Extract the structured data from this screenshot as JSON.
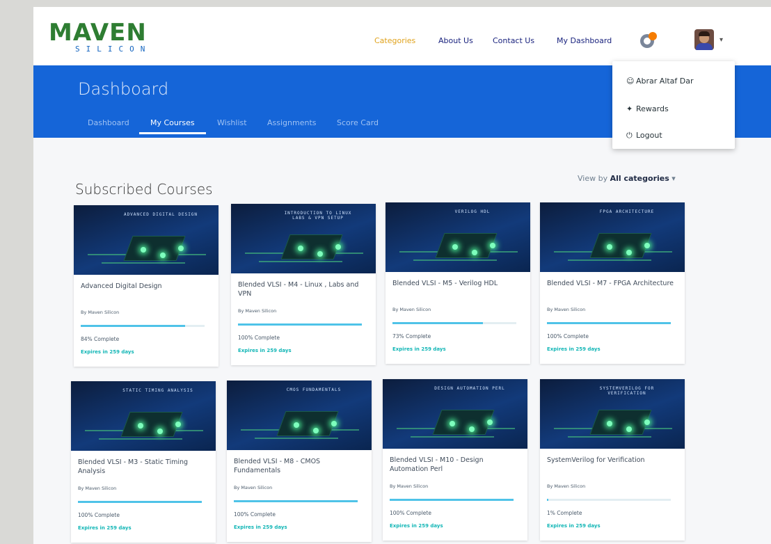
{
  "logo": {
    "main": "MAVEN",
    "sub": "SILICON"
  },
  "nav": [
    "Categories",
    "About Us",
    "Contact Us",
    "My Dashboard"
  ],
  "banner": {
    "title": "Dashboard",
    "tabs": [
      "Dashboard",
      "My Courses",
      "Wishlist",
      "Assignments",
      "Score Card"
    ]
  },
  "user_menu": {
    "items": [
      {
        "icon": "user-icon",
        "label": "Abrar Altaf Dar"
      },
      {
        "icon": "gift-icon",
        "label": "Rewards"
      },
      {
        "icon": "power-icon",
        "label": "Logout"
      }
    ]
  },
  "section_title": "Subscribed Courses",
  "view_by": {
    "prefix": "View by",
    "value": "All categories",
    "caret": "▾"
  },
  "courses": [
    {
      "title": "Advanced Digital Design",
      "by": "By Maven Silicon",
      "progress": 0.84,
      "progress_label": "84% Complete",
      "expire": "Expires in 259 days",
      "thumb_caption": "ADVANCED DIGITAL DESIGN"
    },
    {
      "title": "Blended VLSI - M4 - Linux , Labs and VPN",
      "by": "By Maven Silicon",
      "progress": 1.0,
      "progress_label": "100% Complete",
      "expire": "Expires in 259 days",
      "thumb_caption": "INTRODUCTION TO LINUX LABS & VPN SETUP"
    },
    {
      "title": "Blended VLSI - M5 - Verilog HDL",
      "by": "By Maven Silicon",
      "progress": 0.73,
      "progress_label": "73% Complete",
      "expire": "Expires in 259 days",
      "thumb_caption": "VERILOG HDL"
    },
    {
      "title": "Blended VLSI - M7 - FPGA Architecture",
      "by": "By Maven Silicon",
      "progress": 1.0,
      "progress_label": "100% Complete",
      "expire": "Expires in 259 days",
      "thumb_caption": "FPGA ARCHITECTURE"
    },
    {
      "title": "Blended VLSI - M3 - Static Timing Analysis",
      "by": "By Maven Silicon",
      "progress": 1.0,
      "progress_label": "100% Complete",
      "expire": "Expires in 259 days",
      "thumb_caption": "STATIC TIMING ANALYSIS"
    },
    {
      "title": "Blended VLSI - M8 - CMOS Fundamentals",
      "by": "By Maven Silicon",
      "progress": 1.0,
      "progress_label": "100% Complete",
      "expire": "Expires in 259 days",
      "thumb_caption": "CMOS FUNDAMENTALS"
    },
    {
      "title": "Blended VLSI - M10 - Design Automation Perl",
      "by": "By Maven Silicon",
      "progress": 1.0,
      "progress_label": "100% Complete",
      "expire": "Expires in 259 days",
      "thumb_caption": "DESIGN AUTOMATION PERL"
    },
    {
      "title": "SystemVerilog for Verification",
      "by": "By Maven Silicon",
      "progress": 0.01,
      "progress_label": "1% Complete",
      "expire": "Expires in 259 days",
      "thumb_caption": "SYSTEMVERILOG FOR VERIFICATION"
    }
  ],
  "colors": {
    "banner": "#1565d8",
    "progress": "#4fc3e8",
    "expire": "#12b6b6",
    "logo_green": "#2e7d32",
    "nav_active": "#e0a21b"
  }
}
